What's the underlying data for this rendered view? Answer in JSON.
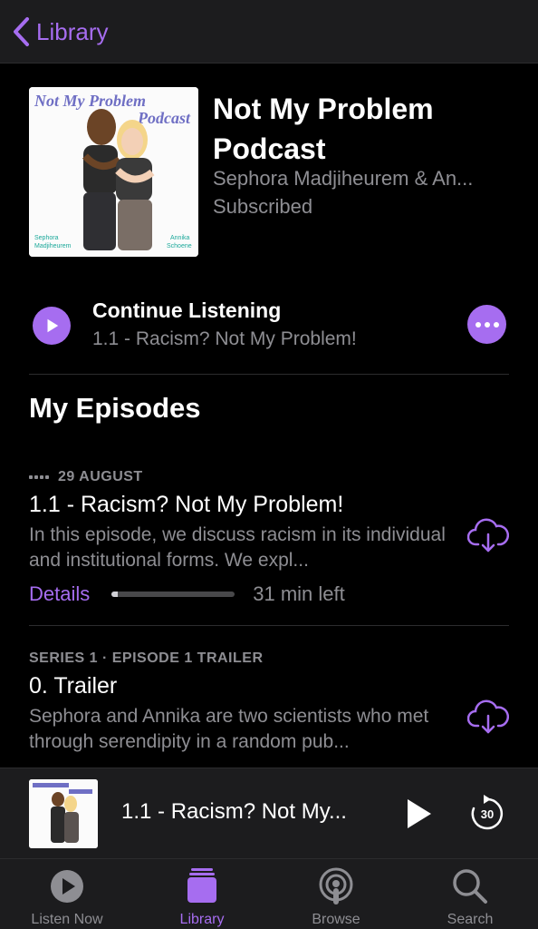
{
  "nav": {
    "back_label": "Library"
  },
  "podcast": {
    "title": "Not My Problem Podcast",
    "authors": "Sephora Madjiheurem & An...",
    "status": "Subscribed",
    "artwork": {
      "title_line1": "Not My Problem",
      "title_line2": "Podcast",
      "host1_line1": "Sephora",
      "host1_line2": "Madjiheurem",
      "host2_line1": "Annika",
      "host2_line2": "Schoene"
    }
  },
  "continue": {
    "label": "Continue Listening",
    "episode": "1.1 - Racism? Not My Problem!"
  },
  "section_title": "My Episodes",
  "episodes": [
    {
      "meta": "29 AUGUST",
      "title": "1.1 - Racism? Not My Problem!",
      "description": "In this episode, we discuss racism in its individual and institutional forms. We expl...",
      "details_label": "Details",
      "progress_fraction": 0.05,
      "time_left": "31 min left"
    },
    {
      "meta": "SERIES 1 · EPISODE 1 TRAILER",
      "title": "0. Trailer",
      "description": "Sephora and Annika are two scientists who met through serendipity in a random pub..."
    }
  ],
  "miniplayer": {
    "title": "1.1 - Racism? Not My..."
  },
  "tabs": [
    {
      "label": "Listen Now",
      "icon": "play-circle-icon",
      "active": false
    },
    {
      "label": "Library",
      "icon": "library-stack-icon",
      "active": true
    },
    {
      "label": "Browse",
      "icon": "podcast-antenna-icon",
      "active": false
    },
    {
      "label": "Search",
      "icon": "search-icon",
      "active": false
    }
  ],
  "colors": {
    "accent": "#a66df0",
    "background": "#000000",
    "secondary_text": "#8e8e93",
    "bar_background": "#1c1c1e"
  }
}
